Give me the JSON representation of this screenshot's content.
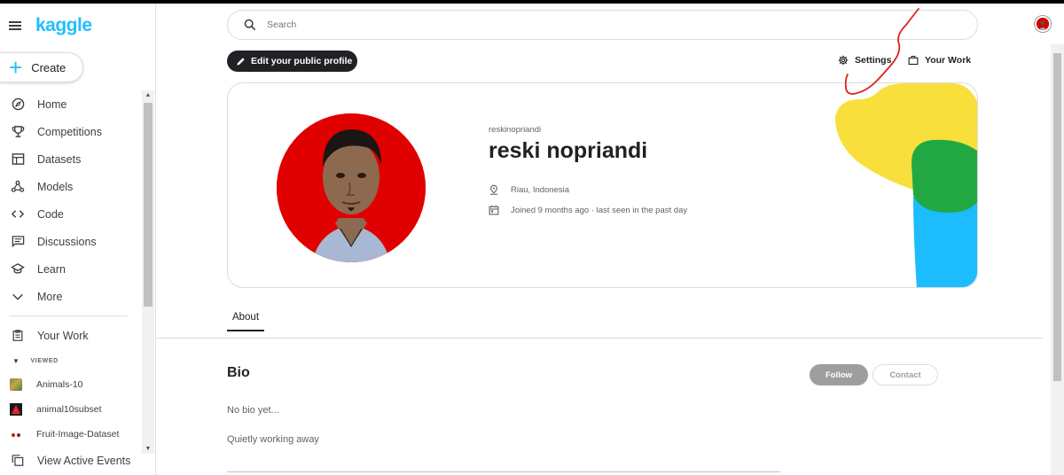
{
  "app": {
    "logo": "kaggle"
  },
  "sidebar": {
    "create_label": "Create",
    "items": [
      {
        "label": "Home",
        "icon": "compass-icon"
      },
      {
        "label": "Competitions",
        "icon": "trophy-icon"
      },
      {
        "label": "Datasets",
        "icon": "table-icon"
      },
      {
        "label": "Models",
        "icon": "models-icon"
      },
      {
        "label": "Code",
        "icon": "code-icon"
      },
      {
        "label": "Discussions",
        "icon": "comments-icon"
      },
      {
        "label": "Learn",
        "icon": "school-icon"
      },
      {
        "label": "More",
        "icon": "chevron-down-icon"
      }
    ],
    "your_work": "Your Work",
    "viewed_header": "VIEWED",
    "viewed": [
      {
        "label": "Animals-10"
      },
      {
        "label": "animal10subset"
      },
      {
        "label": "Fruit-Image-Dataset"
      }
    ],
    "active_events": "View Active Events"
  },
  "search": {
    "placeholder": "Search"
  },
  "header": {
    "edit_profile": "Edit your public profile",
    "settings": "Settings",
    "your_work": "Your Work"
  },
  "profile": {
    "username": "reskinopriandi",
    "display_name": "reski nopriandi",
    "location": "Riau, Indonesia",
    "joined": "Joined 9 months ago · last seen in the past day"
  },
  "tabs": {
    "about": "About"
  },
  "bio": {
    "title": "Bio",
    "follow": "Follow",
    "contact": "Contact",
    "text": "No bio yet...",
    "status": "Quietly working away"
  },
  "colors": {
    "accent": "#20beff",
    "yellow": "#f9df3b",
    "green": "#22a843",
    "blue": "#1cbcff",
    "annotation": "#e0201c"
  }
}
